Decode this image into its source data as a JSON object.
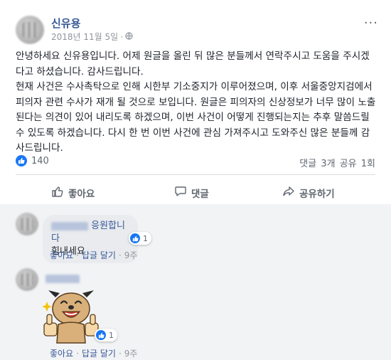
{
  "post": {
    "author": "신유용",
    "date": "2018년 11월 5일",
    "privacy_icon": "globe-icon",
    "paragraph1": "안녕하세요 신유용입니다. 어제 원글을 올린 뒤 많은 분들께서 연락주시고 도움을 주시겠다고 하셨습니다. 감사드립니다.",
    "paragraph2": "현재 사건은 수사촉탁으로 인해 시한부 기소중지가 이루어졌으며, 이후 서울중앙지검에서 피의자 관련 수사가 재개 될 것으로 보입니다. 원글은 피의자의 신상정보가 너무 많이 노출된다는 의견이 있어 내리도록 하겠으며, 이번 사건이 어떻게 진행되는지는 추후 말씀드릴 수 있도록 하겠습니다. 다시 한 번 이번 사건에 관심 가져주시고 도와주신 많은 분들께 감사드립니다."
  },
  "reactions": {
    "count": "140",
    "icon": "like-icon"
  },
  "stats": {
    "comments": "댓글 3개",
    "shares": "공유 1회"
  },
  "actions": {
    "like": "좋아요",
    "comment": "댓글",
    "share": "공유하기"
  },
  "comments": [
    {
      "name_suffix": "응원합니다",
      "text": "힘내세요",
      "likes": "1",
      "like_label": "좋아요",
      "reply_label": "답글 달기",
      "time": "9주"
    },
    {
      "sticker": "thumbs-up-dog-sticker",
      "likes": "1",
      "like_label": "좋아요",
      "reply_label": "답글 달기",
      "time": "9주"
    }
  ],
  "colors": {
    "link": "#385898",
    "accent": "#1877f2",
    "comment_bg": "#f2f3f5"
  }
}
